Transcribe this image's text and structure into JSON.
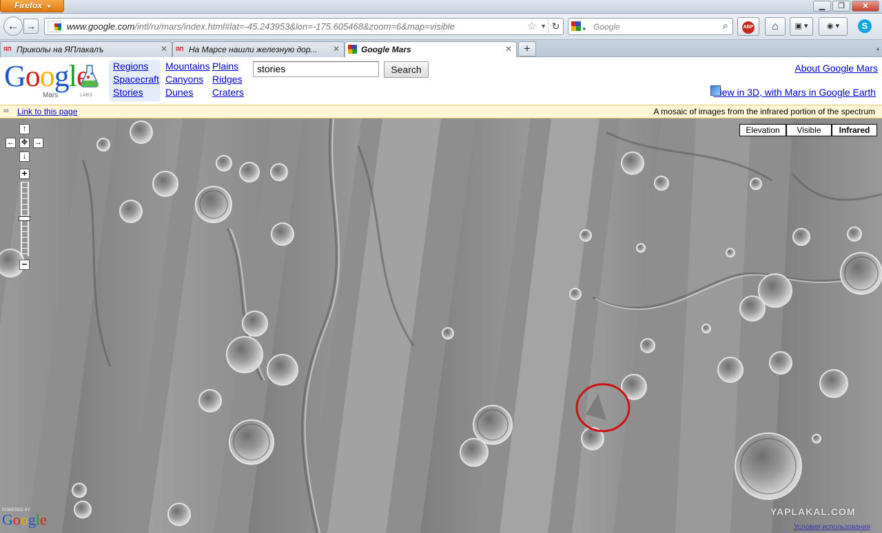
{
  "browser": {
    "app_button": "Firefox",
    "url_host": "www.google.com",
    "url_path": "/intl/ru/mars/index.html#lat=-45.243953&lon=-175.605468&zoom=6&map=visible",
    "search_placeholder": "Google",
    "tabs": [
      {
        "favicon": "ЯП",
        "label": "Приколы на ЯПлакалъ"
      },
      {
        "favicon": "ЯП",
        "label": "На Марсе нашли железную дор..."
      },
      {
        "favicon": "google-favicon",
        "label": "Google Mars"
      }
    ],
    "toolbar_icons": [
      "adblock-plus-icon",
      "home-icon",
      "bookmarks-icon",
      "addon-icon",
      "skype-icon"
    ]
  },
  "header": {
    "logo_text": "Google",
    "logo_sub": "Mars",
    "logo_labs": "LABS",
    "nav_col1": [
      "Regions",
      "Spacecraft",
      "Stories"
    ],
    "nav_col2": [
      "Mountains",
      "Canyons",
      "Dunes"
    ],
    "nav_col3": [
      "Plains",
      "Ridges",
      "Craters"
    ],
    "search_value": "stories",
    "search_button": "Search",
    "about_link": "About Google Mars",
    "earth_link": "View in 3D, with Mars in Google Earth"
  },
  "infobar": {
    "link_label": "Link to this page",
    "description": "A mosaic of images from the infrared portion of the spectrum"
  },
  "map": {
    "map_types": [
      "Elevation",
      "Visible",
      "Infrared"
    ],
    "selected_type": "Infrared",
    "pan": {
      "up": "↑",
      "left": "←",
      "center": "✥",
      "right": "→",
      "down": "↓"
    },
    "zoom_in": "+",
    "zoom_out": "−",
    "powered_by": "POWERED BY",
    "watermark": "YAPLAKAL.COM",
    "terms_text": "Условия использования",
    "highlight_color": "#cc1111"
  }
}
